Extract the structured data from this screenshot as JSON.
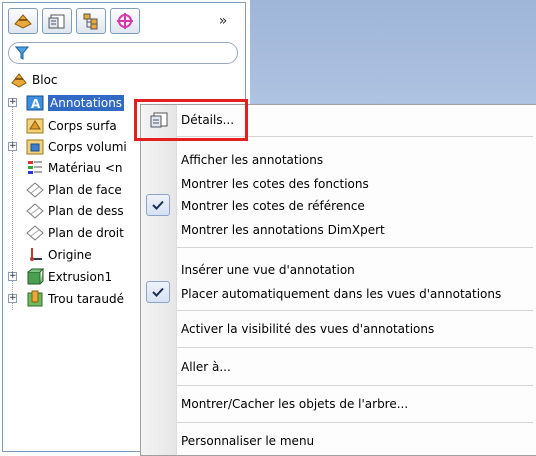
{
  "toolbar": {
    "buttons": [
      {
        "icon": "feature-manager-icon"
      },
      {
        "icon": "property-manager-icon"
      },
      {
        "icon": "configuration-manager-icon"
      },
      {
        "icon": "dimxpert-manager-icon"
      }
    ],
    "more_label": "»"
  },
  "filter": {
    "icon": "filter-icon",
    "value": ""
  },
  "tree": {
    "root": "Bloc",
    "items": [
      {
        "label": "Annotations",
        "icon": "annotations-icon",
        "expandable": true,
        "selected": true
      },
      {
        "label": "Corps surfa",
        "icon": "surface-bodies-icon",
        "expandable": false
      },
      {
        "label": "Corps volumi",
        "icon": "solid-bodies-icon",
        "expandable": true
      },
      {
        "label": "Matériau <n",
        "icon": "material-icon",
        "expandable": false
      },
      {
        "label": "Plan de face",
        "icon": "plane-icon",
        "expandable": false
      },
      {
        "label": "Plan de dess",
        "icon": "plane-icon",
        "expandable": false
      },
      {
        "label": "Plan de droit",
        "icon": "plane-icon",
        "expandable": false
      },
      {
        "label": "Origine",
        "icon": "origin-icon",
        "expandable": false
      },
      {
        "label": "Extrusion1",
        "icon": "extrude-icon",
        "expandable": true
      },
      {
        "label": "Trou taraudé",
        "icon": "hole-icon",
        "expandable": true
      }
    ]
  },
  "menu": {
    "details": "Détails...",
    "items": [
      {
        "label": "Afficher les annotations",
        "checked": false
      },
      {
        "label": "Montrer les cotes des fonctions",
        "checked": false
      },
      {
        "label": "Montrer les cotes de référence",
        "checked": true
      },
      {
        "label": "Montrer les annotations DimXpert",
        "checked": false
      },
      {
        "label": "Insérer une vue d'annotation",
        "checked": false
      },
      {
        "label": "Placer automatiquement dans les vues d'annotations",
        "checked": true
      },
      {
        "label": "Activer la visibilité des vues d'annotations",
        "checked": false
      },
      {
        "label": "Aller à...",
        "checked": false
      },
      {
        "label": "Montrer/Cacher les objets de l'arbre...",
        "checked": false
      },
      {
        "label": "Personnaliser le menu",
        "checked": false
      }
    ]
  },
  "colors": {
    "highlight": "#e32020",
    "selection": "#316ac5"
  }
}
